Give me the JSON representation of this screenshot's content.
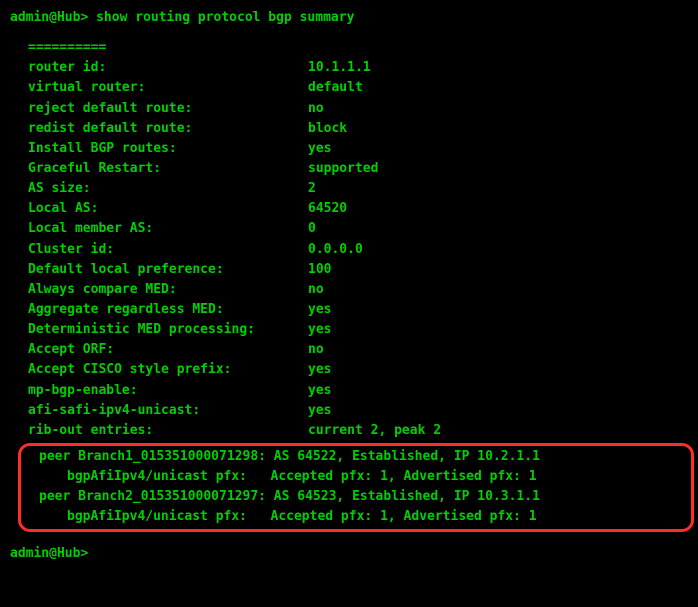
{
  "prompt1": "admin@Hub>",
  "command": "show routing protocol bgp summary",
  "divider": "==========",
  "rows": [
    {
      "label": "router id:",
      "value": "10.1.1.1"
    },
    {
      "label": "virtual router:",
      "value": "default"
    },
    {
      "label": "reject default route:",
      "value": "no"
    },
    {
      "label": "redist default route:",
      "value": "block"
    },
    {
      "label": "Install BGP routes:",
      "value": "yes"
    },
    {
      "label": "Graceful Restart:",
      "value": "supported"
    },
    {
      "label": "AS size:",
      "value": "2"
    },
    {
      "label": "Local AS:",
      "value": "64520"
    },
    {
      "label": "Local member AS:",
      "value": "0"
    },
    {
      "label": "Cluster id:",
      "value": "0.0.0.0"
    },
    {
      "label": "Default local preference:",
      "value": "100"
    },
    {
      "label": "Always compare MED:",
      "value": "no"
    },
    {
      "label": "Aggregate regardless MED:",
      "value": "yes"
    },
    {
      "label": "Deterministic MED processing:",
      "value": "yes"
    },
    {
      "label": "Accept ORF:",
      "value": "no"
    },
    {
      "label": "Accept CISCO style prefix:",
      "value": "yes"
    },
    {
      "label": "mp-bgp-enable:",
      "value": "yes"
    },
    {
      "label": "afi-safi-ipv4-unicast:",
      "value": "yes"
    },
    {
      "label": "rib-out entries:",
      "value": "current 2, peak 2"
    }
  ],
  "peers": [
    {
      "line": "peer Branch1_015351000071298: AS 64522, Established, IP 10.2.1.1",
      "sub": "bgpAfiIpv4/unicast pfx:   Accepted pfx: 1, Advertised pfx: 1"
    },
    {
      "line": "peer Branch2_015351000071297: AS 64523, Established, IP 10.3.1.1",
      "sub": "bgpAfiIpv4/unicast pfx:   Accepted pfx: 1, Advertised pfx: 1"
    }
  ],
  "prompt2": "admin@Hub>"
}
